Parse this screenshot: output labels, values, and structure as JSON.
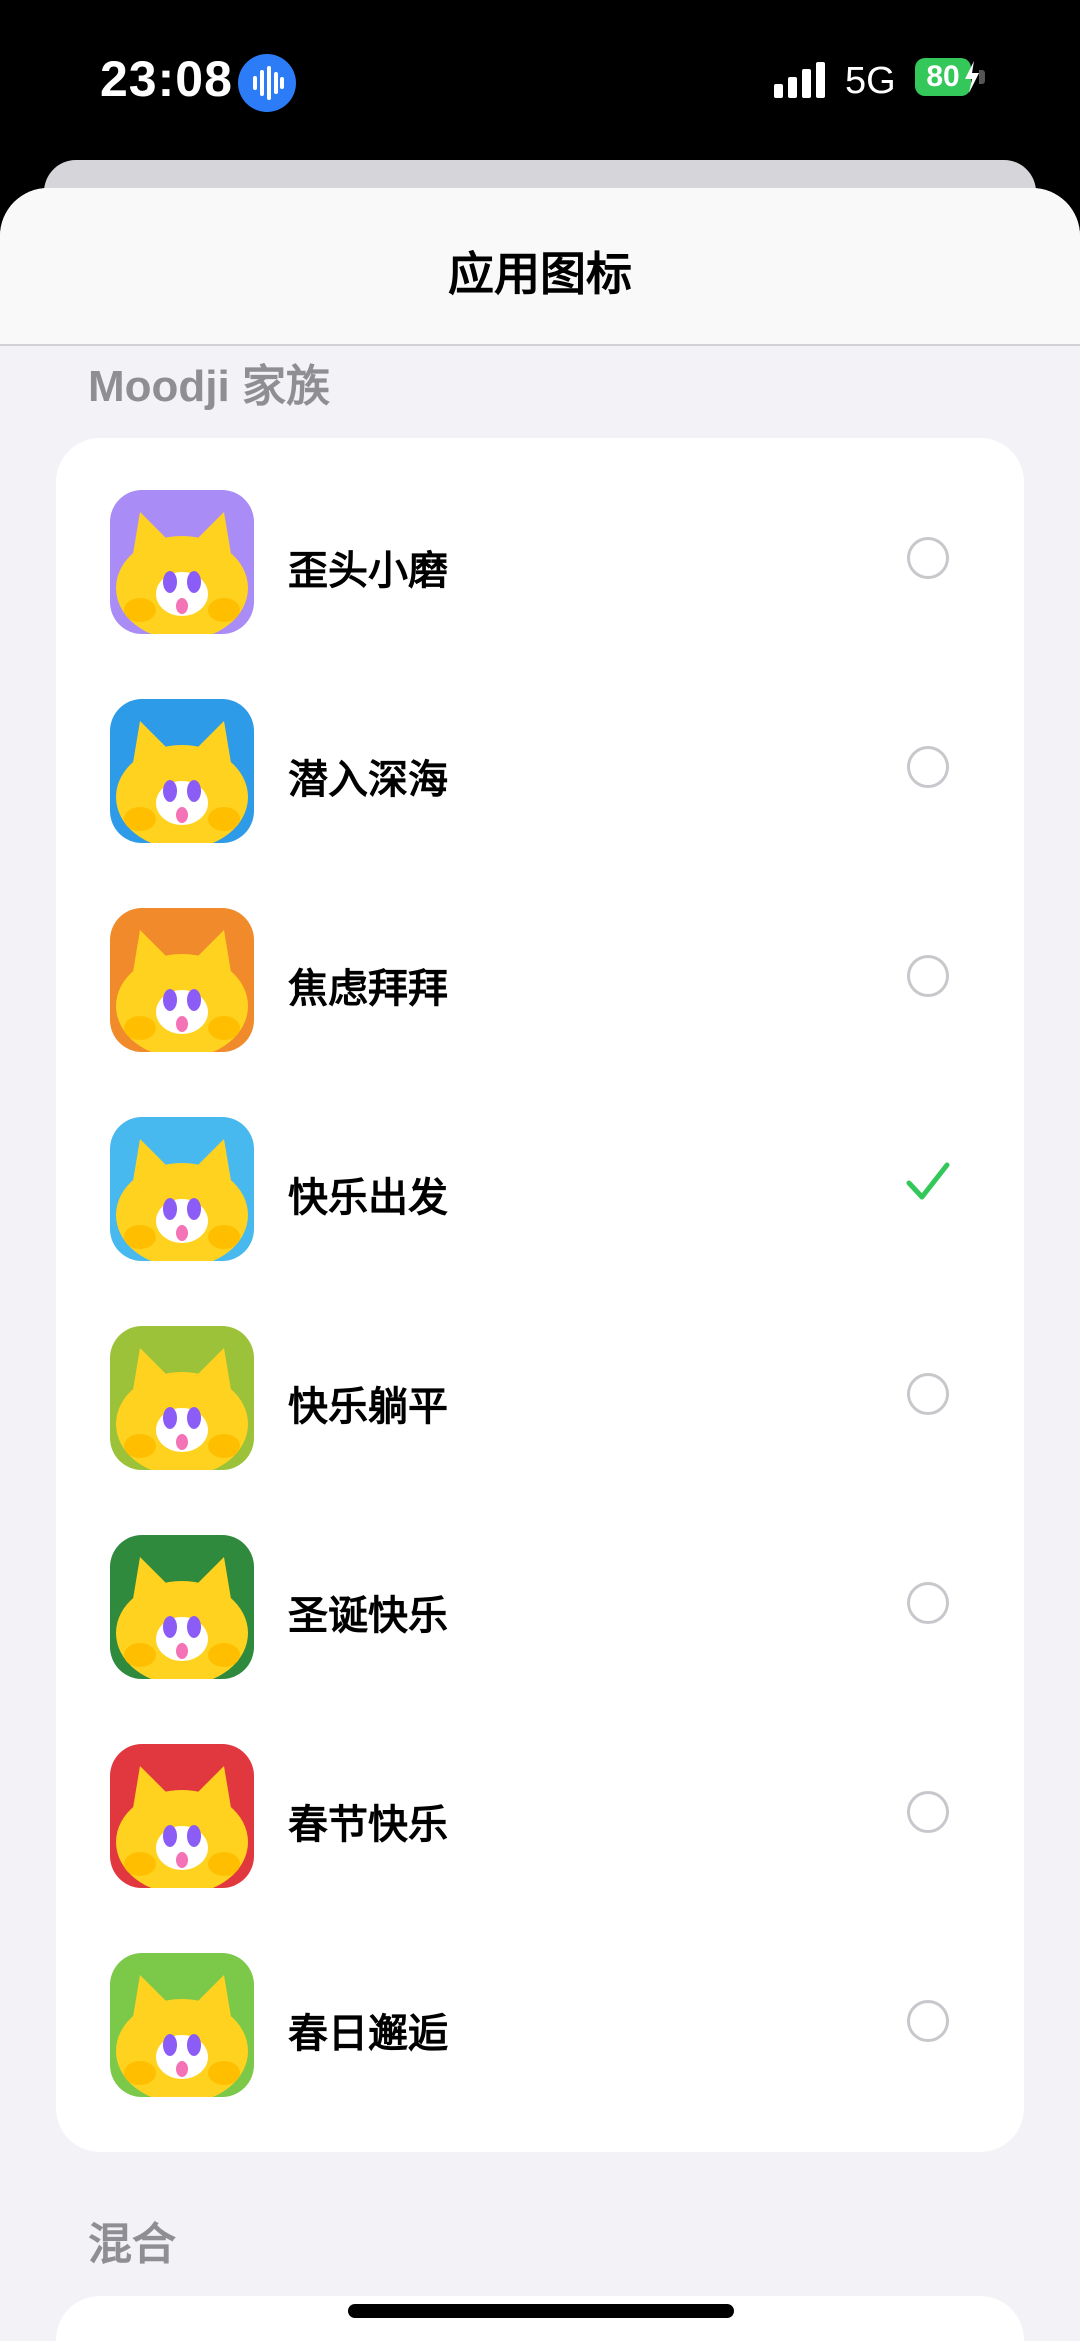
{
  "status_bar": {
    "time": "23:08",
    "network": "5G",
    "battery": "80",
    "icons": [
      "voice-assistant-icon",
      "signal-icon",
      "battery-icon",
      "charging-bolt-icon"
    ]
  },
  "sheet": {
    "title": "应用图标"
  },
  "sections": [
    {
      "label": "Moodji 家族",
      "items": [
        {
          "label": "歪头小磨",
          "selected": false,
          "icon_bg": "#a98cf5",
          "icon_accent": "#ffd21f"
        },
        {
          "label": "潜入深海",
          "selected": false,
          "icon_bg": "#2e9be8",
          "icon_accent": "#ffd21f"
        },
        {
          "label": "焦虑拜拜",
          "selected": false,
          "icon_bg": "#f08a2b",
          "icon_accent": "#ffd21f"
        },
        {
          "label": "快乐出发",
          "selected": true,
          "icon_bg": "#48b9ee",
          "icon_accent": "#ffd21f"
        },
        {
          "label": "快乐躺平",
          "selected": false,
          "icon_bg": "#9cc23a",
          "icon_accent": "#ffd21f"
        },
        {
          "label": "圣诞快乐",
          "selected": false,
          "icon_bg": "#2f8a3e",
          "icon_accent": "#ffd21f"
        },
        {
          "label": "春节快乐",
          "selected": false,
          "icon_bg": "#e0383e",
          "icon_accent": "#ffd21f"
        },
        {
          "label": "春日邂逅",
          "selected": false,
          "icon_bg": "#7cc94a",
          "icon_accent": "#ffd21f"
        }
      ]
    },
    {
      "label": "混合",
      "items": []
    }
  ],
  "colors": {
    "accent_check": "#34c759",
    "radio_border": "#c7c7cc",
    "section_label": "#8e8e93",
    "sheet_bg": "#f2f2f7"
  }
}
